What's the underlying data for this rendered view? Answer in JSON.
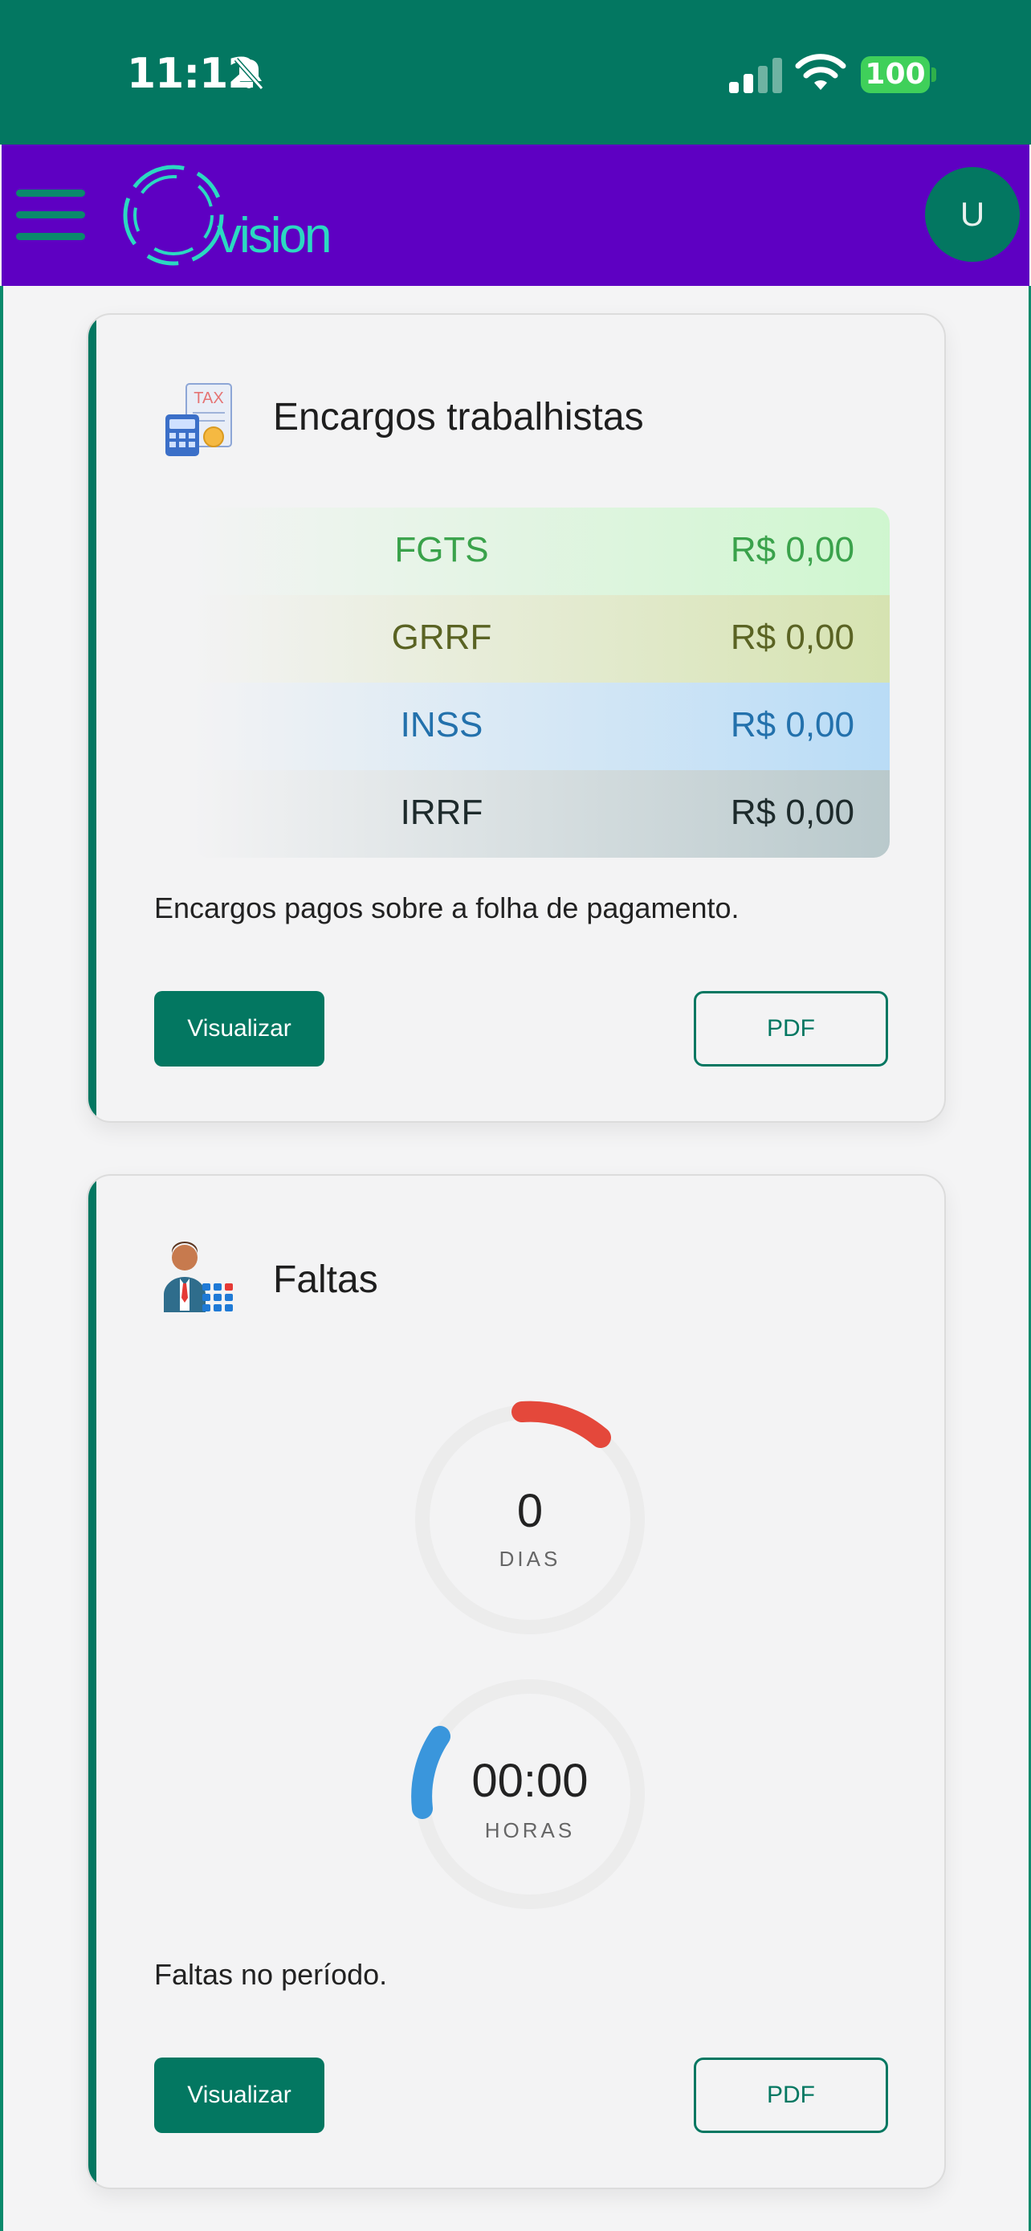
{
  "status_bar": {
    "time": "11:12",
    "battery": "100",
    "icons": [
      "bell-slash-icon",
      "cellular-signal-icon",
      "wifi-icon",
      "battery-icon"
    ]
  },
  "app_bar": {
    "logo_text": "vision",
    "avatar_initial": "U",
    "color": "#5e00c2"
  },
  "cards": {
    "encargos": {
      "title": "Encargos trabalhistas",
      "icon": "tax-calculator-icon",
      "rows": [
        {
          "label": "FGTS",
          "value": "R$ 0,00"
        },
        {
          "label": "GRRF",
          "value": "R$ 0,00"
        },
        {
          "label": "INSS",
          "value": "R$ 0,00"
        },
        {
          "label": "IRRF",
          "value": "R$ 0,00"
        }
      ],
      "description": "Encargos pagos sobre a folha de pagamento.",
      "view_label": "Visualizar",
      "pdf_label": "PDF"
    },
    "faltas": {
      "title": "Faltas",
      "icon": "employee-calendar-icon",
      "days": {
        "value": "0",
        "unit": "DIAS",
        "color": "#e4483b"
      },
      "hours": {
        "value": "00:00",
        "unit": "HORAS",
        "color": "#3a96dc"
      },
      "description": "Faltas no período.",
      "view_label": "Visualizar",
      "pdf_label": "PDF"
    }
  },
  "colors": {
    "primary": "#037761",
    "appbar": "#5e00c2",
    "logo": "#2bd9c1"
  }
}
